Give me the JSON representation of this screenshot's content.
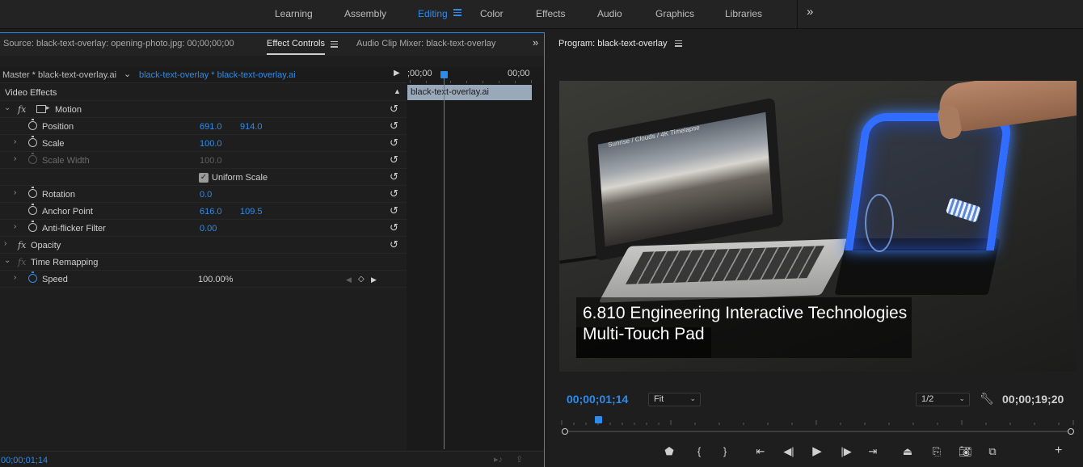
{
  "workspaces": [
    "Learning",
    "Assembly",
    "Editing",
    "Color",
    "Effects",
    "Audio",
    "Graphics",
    "Libraries"
  ],
  "active_workspace": "Editing",
  "left_panel": {
    "tabs": {
      "source": "Source: black-text-overlay: opening-photo.jpg: 00;00;00;00",
      "effect_controls": "Effect Controls",
      "audio_mixer": "Audio Clip Mixer: black-text-overlay"
    },
    "master_label": "Master * black-text-overlay.ai",
    "clip_label": "black-text-overlay * black-text-overlay.ai",
    "section": "Video Effects",
    "effects": {
      "motion": "Motion",
      "position": {
        "label": "Position",
        "x": "691.0",
        "y": "914.0"
      },
      "scale": {
        "label": "Scale",
        "value": "100.0"
      },
      "scale_width": {
        "label": "Scale Width",
        "value": "100.0"
      },
      "uniform_scale": {
        "label": "Uniform Scale",
        "checked": true
      },
      "rotation": {
        "label": "Rotation",
        "value": "0.0"
      },
      "anchor_point": {
        "label": "Anchor Point",
        "x": "616.0",
        "y": "109.5"
      },
      "anti_flicker": {
        "label": "Anti-flicker Filter",
        "value": "0.00"
      },
      "opacity": "Opacity",
      "time_remapping": "Time Remapping",
      "speed": {
        "label": "Speed",
        "value": "100.00%"
      }
    },
    "mini_timeline": {
      "start": ";00;00",
      "end": "00;00",
      "clip_name": "black-text-overlay.ai"
    },
    "current_time": "00;00;01;14"
  },
  "program": {
    "title": "Program: black-text-overlay",
    "overlay_text": {
      "line1": "6.810 Engineering Interactive Technologies",
      "line2": "Multi-Touch Pad"
    },
    "screen_text": "Sunrise / Clouds / 4K Timelapse",
    "current_time": "00;00;01;14",
    "fit": "Fit",
    "resolution": "1/2",
    "duration": "00;00;19;20"
  },
  "colors": {
    "accent": "#2d8ceb",
    "panel": "#1e1e1e",
    "text": "#cfcfcf"
  },
  "icons": {
    "transport": [
      "marker-icon",
      "mark-in-icon",
      "mark-out-icon",
      "go-to-in-icon",
      "step-back-icon",
      "play-icon",
      "step-forward-icon",
      "go-to-out-icon",
      "lift-icon",
      "extract-icon",
      "export-frame-icon",
      "compare-icon",
      "add-button-icon"
    ]
  }
}
